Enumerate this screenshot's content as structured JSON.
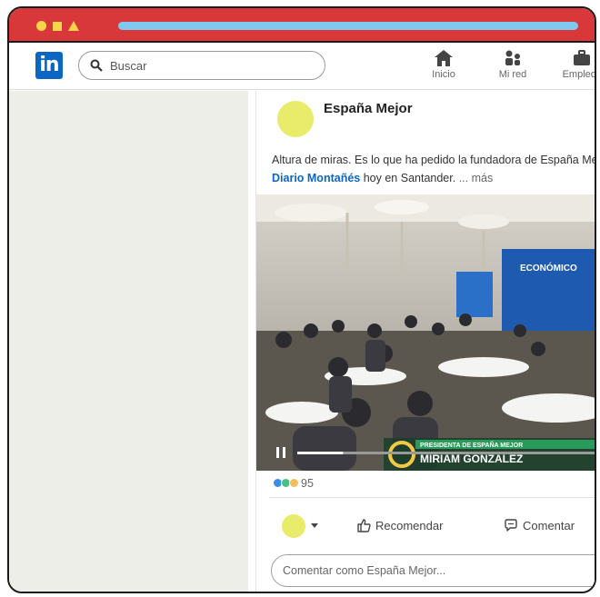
{
  "nav": {
    "search_placeholder": "Buscar",
    "items": [
      {
        "label": "Inicio",
        "icon": "home-icon"
      },
      {
        "label": "Mi red",
        "icon": "people-icon"
      },
      {
        "label": "Empleos",
        "icon": "briefcase-icon"
      }
    ],
    "logo": "in"
  },
  "post": {
    "author": "España Mejor",
    "text_line1": "Altura de miras. Es lo que ha pedido la fundadora de España Mejor",
    "text_link": "Diario Montañés",
    "text_line2_rest": " hoy en Santander.",
    "more_label": "... más",
    "video": {
      "banner_top": "PRESIDENTA DE ESPAÑA MEJOR",
      "banner_name": "MIRIAM GONZÁLEZ",
      "screen_text": "ECONÓMICO",
      "progress": 0.15
    },
    "reaction_count": "95",
    "actions": {
      "like": "Recomendar",
      "comment": "Comentar"
    },
    "comment_placeholder": "Comentar como España Mejor..."
  },
  "colors": {
    "titlebar": "#d9383a",
    "accent": "#0a66c2",
    "avatar": "#e8ec6a"
  }
}
